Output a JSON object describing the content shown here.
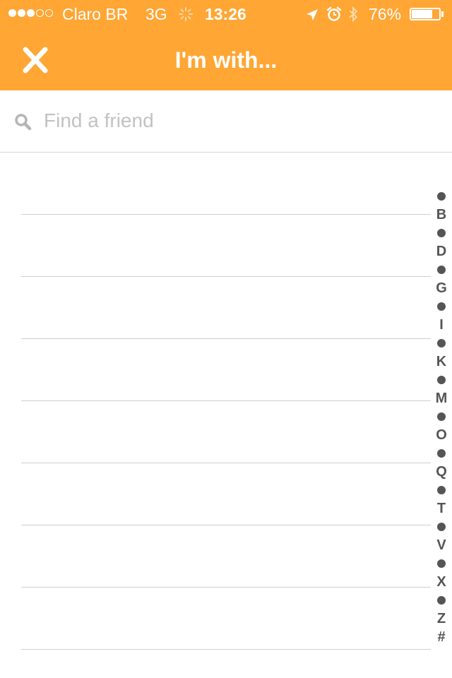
{
  "status_bar": {
    "signal_strength": "3 of 5",
    "carrier": "Claro BR",
    "network": "3G",
    "time": "13:26",
    "battery_percent": "76%",
    "battery_level": 0.76
  },
  "header": {
    "title": "I'm with...",
    "close_icon": "close-icon",
    "background_color": "#ffa634"
  },
  "search": {
    "placeholder": "Find a friend",
    "value": ""
  },
  "friend_list": {
    "rows": 8
  },
  "index_bar": {
    "items": [
      "•",
      "B",
      "•",
      "D",
      "•",
      "G",
      "•",
      "I",
      "•",
      "K",
      "•",
      "M",
      "•",
      "O",
      "•",
      "Q",
      "•",
      "T",
      "•",
      "V",
      "•",
      "X",
      "•",
      "Z",
      "#"
    ]
  }
}
